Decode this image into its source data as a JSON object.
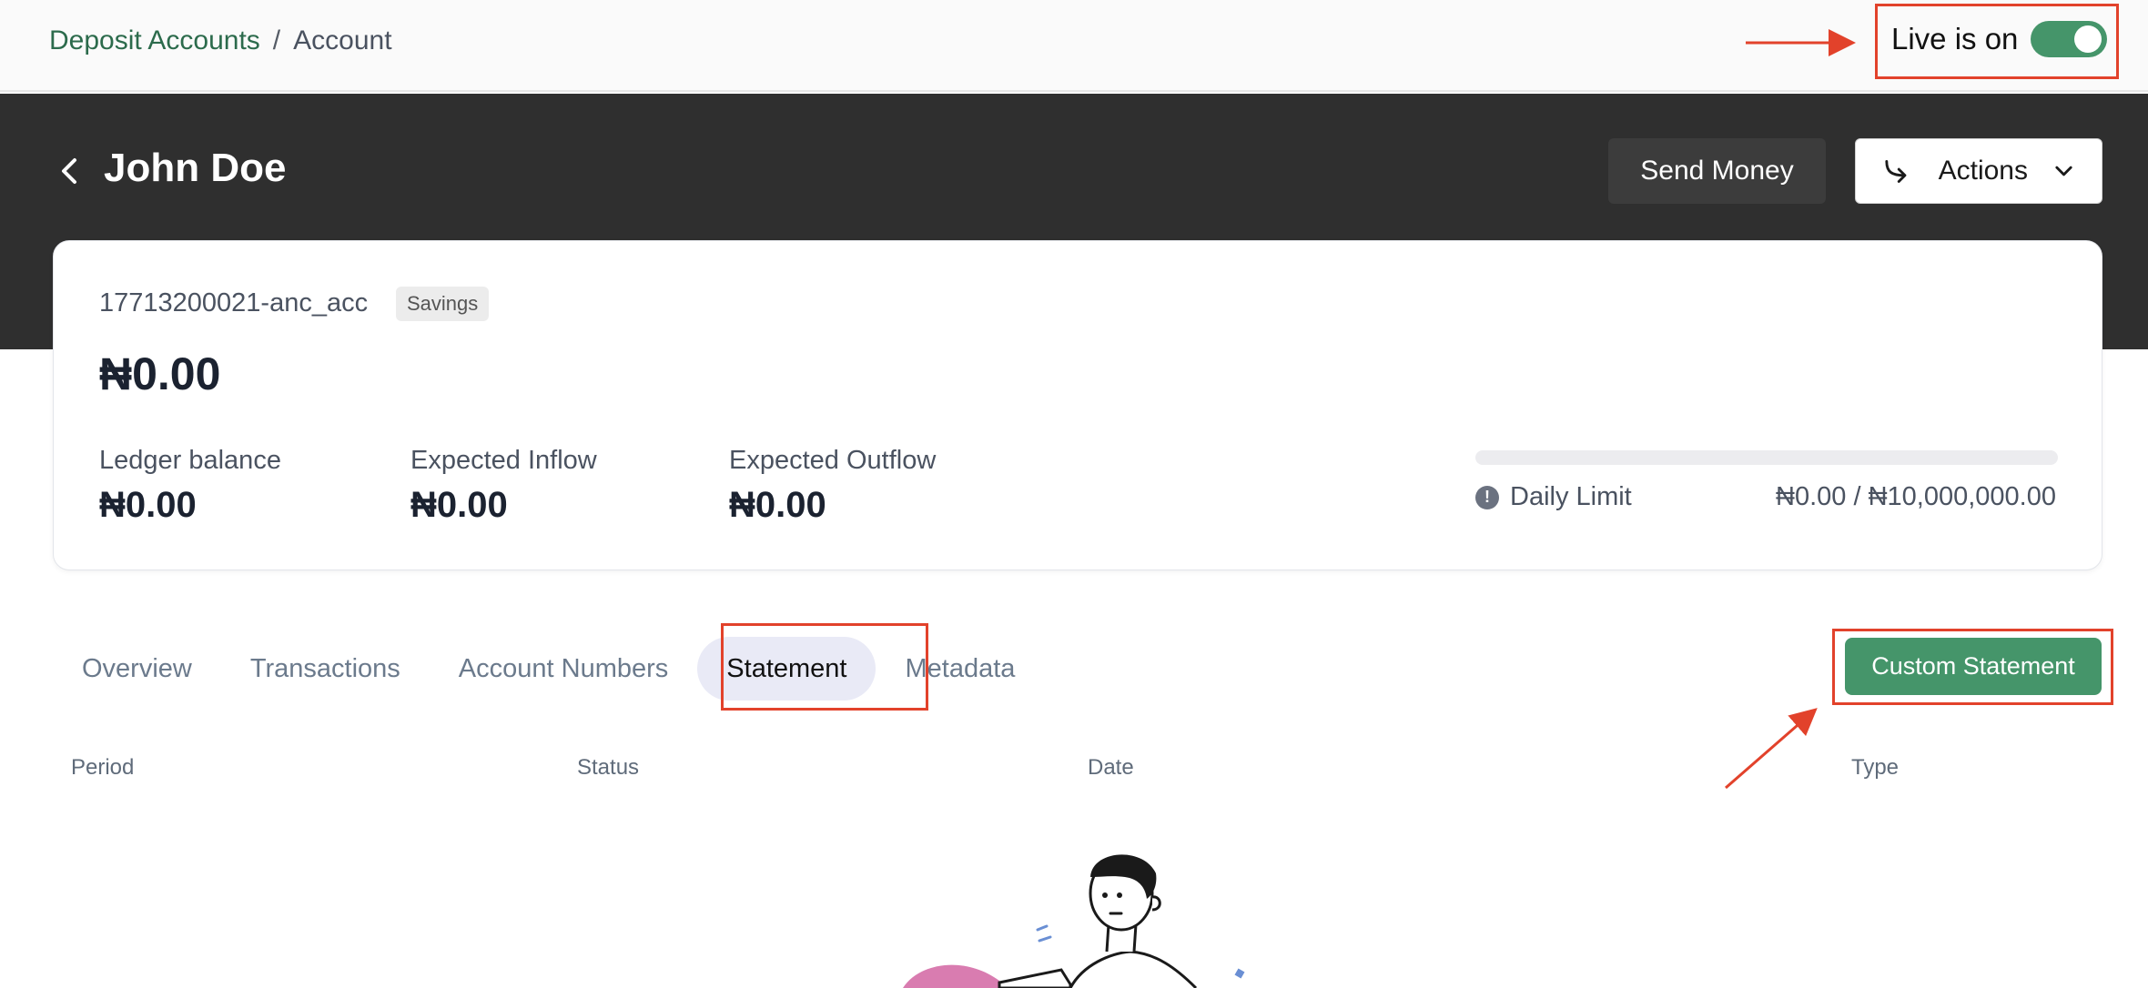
{
  "breadcrumb": {
    "parent": "Deposit Accounts",
    "separator": "/",
    "current": "Account"
  },
  "live": {
    "label": "Live is on",
    "enabled": true
  },
  "header": {
    "title": "John Doe",
    "send_money": "Send Money",
    "actions": "Actions"
  },
  "account": {
    "id": "17713200021-anc_acc",
    "type_badge": "Savings",
    "balance": "₦0.00",
    "ledger_label": "Ledger balance",
    "ledger_value": "₦0.00",
    "inflow_label": "Expected Inflow",
    "inflow_value": "₦0.00",
    "outflow_label": "Expected Outflow",
    "outflow_value": "₦0.00",
    "daily_limit_label": "Daily Limit",
    "daily_limit_value": "₦0.00 / ₦10,000,000.00",
    "daily_limit_used_fraction": 0
  },
  "tabs": [
    {
      "label": "Overview"
    },
    {
      "label": "Transactions"
    },
    {
      "label": "Account Numbers"
    },
    {
      "label": "Statement",
      "active": true
    },
    {
      "label": "Metadata"
    }
  ],
  "custom_statement": "Custom Statement",
  "table": {
    "columns": [
      "Period",
      "Status",
      "Date",
      "Type"
    ]
  },
  "colors": {
    "accent": "#45956a",
    "header_bg": "#2f2f2f",
    "highlight": "#e2422b"
  },
  "icons": [
    "chevron-left-icon",
    "share-arrow-icon",
    "chevron-down-icon",
    "info-icon"
  ]
}
